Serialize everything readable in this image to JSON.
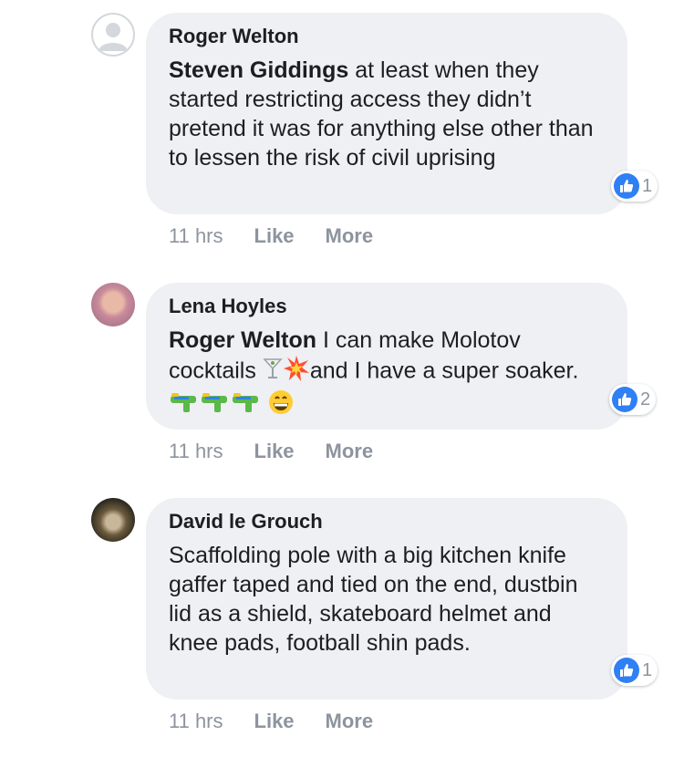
{
  "comments": [
    {
      "author": "Roger Welton",
      "mention": "Steven Giddings",
      "text": " at least when they started restricting access they didn’t pretend it was for anything else other than to lessen the risk of civil uprising",
      "reactions": "1",
      "time": "11 hrs",
      "like_label": "Like",
      "more_label": "More"
    },
    {
      "author": "Lena Hoyles",
      "mention": "Roger Welton",
      "text_part1": " I can make Molotov cocktails ",
      "text_part2": "and I have a super soaker. ",
      "emoji_names": [
        "cocktail-glass-icon",
        "collision-icon",
        "water-pistol-icon",
        "water-pistol-icon",
        "water-pistol-icon",
        "grinning-face-icon"
      ],
      "reactions": "2",
      "time": "11 hrs",
      "like_label": "Like",
      "more_label": "More"
    },
    {
      "author": "David le Grouch",
      "text": "Scaffolding pole with a big kitchen knife gaffer taped and tied on the end, dustbin lid as a shield, skateboard helmet and knee pads, football shin pads.",
      "reactions": "1",
      "time": "11 hrs",
      "like_label": "Like",
      "more_label": "More"
    }
  ],
  "colors": {
    "bubble": "#eef0f3",
    "like_blue": "#2f7ff5",
    "meta_gray": "#8d949e",
    "text": "#1c1e21"
  }
}
